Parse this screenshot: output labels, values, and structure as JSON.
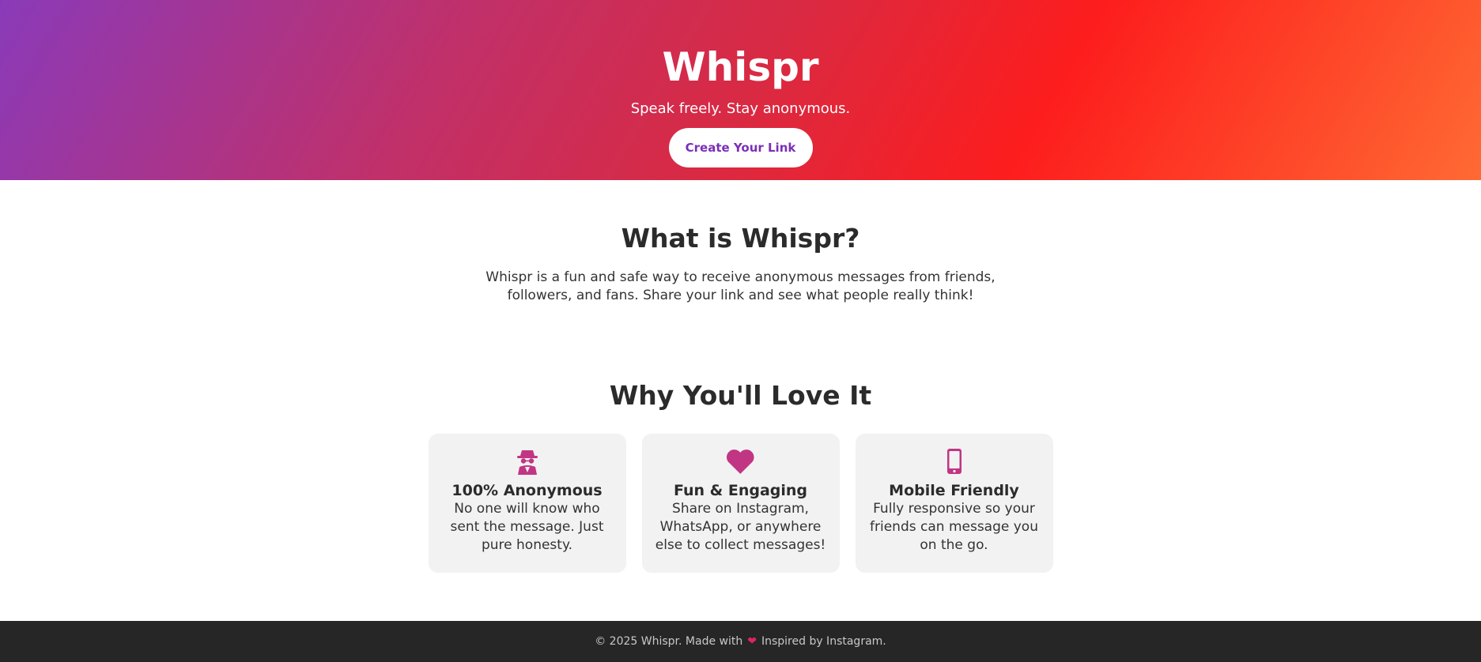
{
  "hero": {
    "title": "Whispr",
    "tagline": "Speak freely. Stay anonymous.",
    "cta_label": "Create Your Link"
  },
  "about": {
    "heading": "What is Whispr?",
    "body": "Whispr is a fun and safe way to receive anonymous messages from friends, followers, and fans. Share your link and see what people really think!"
  },
  "features": {
    "heading": "Why You'll Love It",
    "cards": [
      {
        "icon": "incognito-icon",
        "title": "100% Anonymous",
        "text": "No one will know who sent the message. Just pure honesty."
      },
      {
        "icon": "heart-icon",
        "title": "Fun & Engaging",
        "text": "Share on Instagram, WhatsApp, or anywhere else to collect messages!"
      },
      {
        "icon": "mobile-phone-icon",
        "title": "Mobile Friendly",
        "text": "Fully responsive so your friends can message you on the go."
      }
    ]
  },
  "footer": {
    "prefix": "© 2025 Whispr. Made with",
    "icon": "heart-icon",
    "suffix": "Inspired by Instagram."
  },
  "colors": {
    "accent": "#c13584",
    "cta_text": "#7b2fb8",
    "footer_bg": "#262626",
    "gradient": [
      "#8a3ab9",
      "#fd1d1d",
      "#ff6a33"
    ]
  }
}
